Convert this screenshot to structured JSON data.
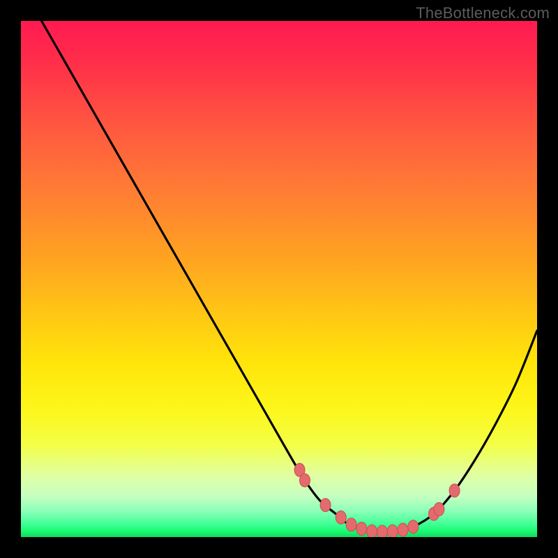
{
  "watermark": "TheBottleneck.com",
  "colors": {
    "background": "#000000",
    "curve": "#000000",
    "marker_fill": "#e36a6d",
    "marker_stroke": "#c94f52",
    "watermark": "#5c5c5c"
  },
  "chart_data": {
    "type": "line",
    "title": "",
    "xlabel": "",
    "ylabel": "",
    "xlim": [
      0,
      100
    ],
    "ylim": [
      0,
      100
    ],
    "grid": false,
    "legend": false,
    "series": [
      {
        "name": "curve",
        "x": [
          4,
          8,
          12,
          16,
          20,
          24,
          28,
          32,
          36,
          40,
          44,
          48,
          52,
          55,
          58,
          61,
          63,
          65,
          67,
          70,
          73,
          76,
          80,
          84,
          88,
          92,
          96,
          100
        ],
        "y": [
          100,
          93,
          86,
          79,
          72,
          65,
          58,
          51,
          44,
          37,
          30,
          23,
          16,
          11,
          7,
          4.5,
          2.8,
          1.8,
          1.2,
          1.0,
          1.2,
          2.0,
          4.5,
          9,
          15,
          22,
          30,
          40
        ]
      }
    ],
    "markers": {
      "name": "highlight-points",
      "x": [
        54,
        55,
        59,
        62,
        64,
        66,
        68,
        70,
        72,
        74,
        76,
        80,
        81,
        84
      ],
      "y": [
        13,
        11,
        6.2,
        3.8,
        2.4,
        1.6,
        1.1,
        1.0,
        1.1,
        1.4,
        2.0,
        4.5,
        5.4,
        9.0
      ]
    }
  }
}
